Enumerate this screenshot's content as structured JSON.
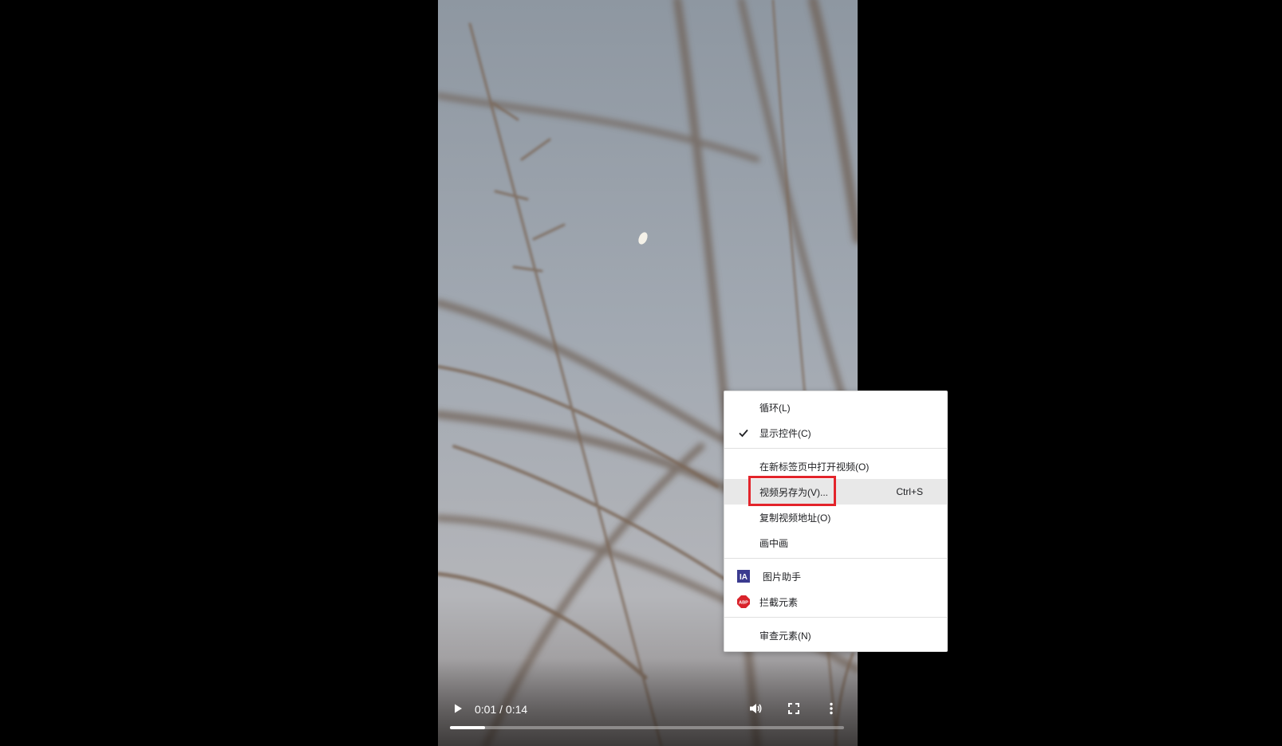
{
  "video": {
    "current_time": "0:01",
    "separator": "/",
    "duration": "0:14",
    "progress_fraction": 0.09,
    "icons": [
      "play-icon",
      "volume-icon",
      "fullscreen-icon",
      "more-options-icon"
    ]
  },
  "context_menu": {
    "items": [
      {
        "label": "循环(L)",
        "checked": false
      },
      {
        "label": "显示控件(C)",
        "checked": true
      },
      {
        "label": "在新标签页中打开视频(O)"
      },
      {
        "label": "视频另存为(V)...",
        "shortcut": "Ctrl+S",
        "highlighted": true
      },
      {
        "label": "复制视频地址(O)"
      },
      {
        "label": "画中画"
      },
      {
        "label": "图片助手",
        "icon": "image-assistant-icon",
        "icon_text": "IA"
      },
      {
        "label": "拦截元素",
        "icon": "adblock-icon",
        "icon_text": "ABP"
      },
      {
        "label": "审查元素(N)"
      }
    ]
  },
  "annotation": {
    "highlight_color": "#e3242b"
  }
}
